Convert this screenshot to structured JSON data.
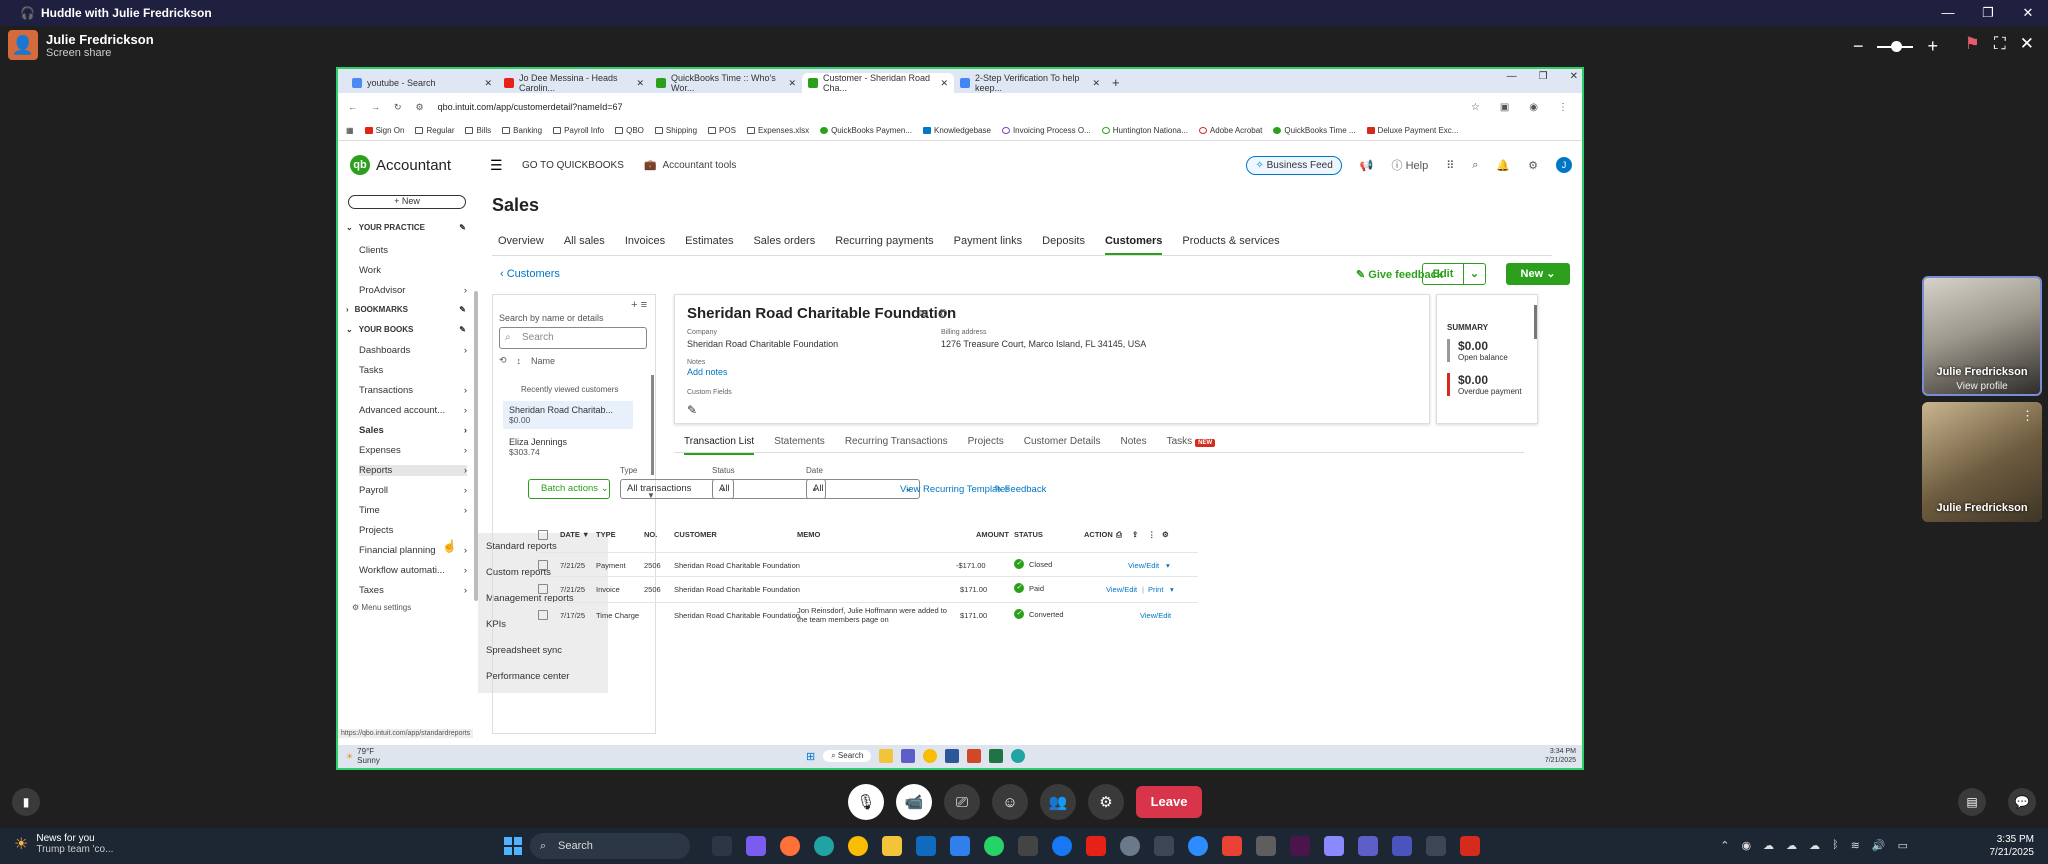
{
  "teams": {
    "window_title": "Huddle with Julie Fredrickson",
    "presenter_name": "Julie Fredrickson",
    "presenter_status": "Screen share",
    "leave_label": "Leave",
    "participants": [
      {
        "name": "Julie Fredrickson",
        "sub": "View profile"
      },
      {
        "name": "Julie Fredrickson"
      }
    ]
  },
  "browser": {
    "tabs": [
      {
        "label": "youtube - Search",
        "fav": "#4b8af5"
      },
      {
        "label": "Jo Dee Messina - Heads Carolin...",
        "fav": "#e62117"
      },
      {
        "label": "QuickBooks Time :: Who's Wor...",
        "fav": "#2ca01c"
      },
      {
        "label": "Customer - Sheridan Road Cha...",
        "fav": "#2ca01c",
        "active": true
      },
      {
        "label": "2-Step Verification To help keep...",
        "fav": "#4285f4"
      }
    ],
    "url": "qbo.intuit.com/app/customerdetail?nameId=67",
    "bookmarks": [
      "Sign On",
      "Regular",
      "Bills",
      "Banking",
      "Payroll Info",
      "QBO",
      "Shipping",
      "POS",
      "Expenses.xlsx",
      "QuickBooks Paymen...",
      "Knowledgebase",
      "Invoicing Process O...",
      "Huntington Nationa...",
      "Adobe Acrobat",
      "QuickBooks Time ...",
      "Deluxe Payment Exc..."
    ]
  },
  "qbo": {
    "brand": "Accountant",
    "goto": "GO TO QUICKBOOKS",
    "accountant_tools": "Accountant tools",
    "business_feed": "Business Feed",
    "help": "Help",
    "avatar": "J",
    "new_label": "+ New",
    "sidebar": {
      "your_practice": "YOUR PRACTICE",
      "practice_items": [
        "Clients",
        "Work",
        "ProAdvisor"
      ],
      "bookmarks": "BOOKMARKS",
      "your_books": "YOUR BOOKS",
      "book_items": [
        "Dashboards",
        "Tasks",
        "Transactions",
        "Advanced account...",
        "Sales",
        "Expenses",
        "Reports",
        "Payroll",
        "Time",
        "Projects",
        "Financial planning",
        "Workflow automati...",
        "Taxes"
      ],
      "menu_settings": "Menu settings",
      "status_url": "https://qbo.intuit.com/app/standardreports"
    },
    "reports_menu": [
      "Standard reports",
      "Custom reports",
      "Management reports",
      "KPIs",
      "Spreadsheet sync",
      "Performance center"
    ],
    "page_title": "Sales",
    "nav": [
      "Overview",
      "All sales",
      "Invoices",
      "Estimates",
      "Sales orders",
      "Recurring payments",
      "Payment links",
      "Deposits",
      "Customers",
      "Products & services"
    ],
    "nav_active": "Customers",
    "breadcrumb": "Customers",
    "give_feedback": "Give feedback",
    "edit_label": "Edit",
    "new_btn": "New",
    "customer_list": {
      "search_label": "Search by name or details",
      "search_placeholder": "Search",
      "name_header": "Name",
      "recent": "Recently viewed customers",
      "items": [
        {
          "name": "Sheridan Road Charitab...",
          "amount": "$0.00"
        },
        {
          "name": "Eliza Jennings",
          "amount": "$303.74"
        }
      ]
    },
    "customer": {
      "name": "Sheridan Road Charitable Foundation",
      "company_label": "Company",
      "company": "Sheridan Road Charitable Foundation",
      "billing_label": "Billing address",
      "billing": "1276 Treasure Court, Marco Island, FL 34145, USA",
      "notes_label": "Notes",
      "add_notes": "Add notes",
      "custom_fields": "Custom Fields"
    },
    "summary": {
      "title": "SUMMARY",
      "open_amount": "$0.00",
      "open_label": "Open balance",
      "overdue_amount": "$0.00",
      "overdue_label": "Overdue payment"
    },
    "subtabs": [
      "Transaction List",
      "Statements",
      "Recurring Transactions",
      "Projects",
      "Customer Details",
      "Notes",
      "Tasks"
    ],
    "subtab_badge": "NEW",
    "filters": {
      "batch": "Batch actions",
      "type_label": "Type",
      "type_value": "All transactions",
      "status_label": "Status",
      "status_value": "All",
      "date_label": "Date",
      "date_value": "All",
      "view_recurring": "View Recurring Templates",
      "feedback": "Feedback"
    },
    "table": {
      "headers": [
        "DATE ▼",
        "TYPE",
        "NO.",
        "CUSTOMER",
        "MEMO",
        "AMOUNT",
        "STATUS",
        "ACTION"
      ],
      "rows": [
        {
          "date": "7/21/25",
          "type": "Payment",
          "no": "2506",
          "customer": "Sheridan Road Charitable Foundation",
          "memo": "",
          "amount": "-$171.00",
          "status": "Closed",
          "action": "View/Edit",
          "action2": ""
        },
        {
          "date": "7/21/25",
          "type": "Invoice",
          "no": "2506",
          "customer": "Sheridan Road Charitable Foundation",
          "memo": "",
          "amount": "$171.00",
          "status": "Paid",
          "action": "View/Edit",
          "action2": "Print"
        },
        {
          "date": "7/17/25",
          "type": "Time Charge",
          "no": "",
          "customer": "Sheridan Road Charitable Foundation",
          "memo": "Jon Reinsdorf, Julie Hoffmann were added to the team members page on",
          "amount": "$171.00",
          "status": "Converted",
          "action": "View/Edit",
          "action2": ""
        }
      ]
    }
  },
  "remote_taskbar": {
    "weather_temp": "79°F",
    "weather_desc": "Sunny",
    "search": "Search",
    "time": "3:34 PM",
    "date": "7/21/2025"
  },
  "windows": {
    "news_title": "News for you",
    "news_sub": "Trump team 'co...",
    "search": "Search",
    "time": "3:35 PM",
    "date": "7/21/2025"
  }
}
